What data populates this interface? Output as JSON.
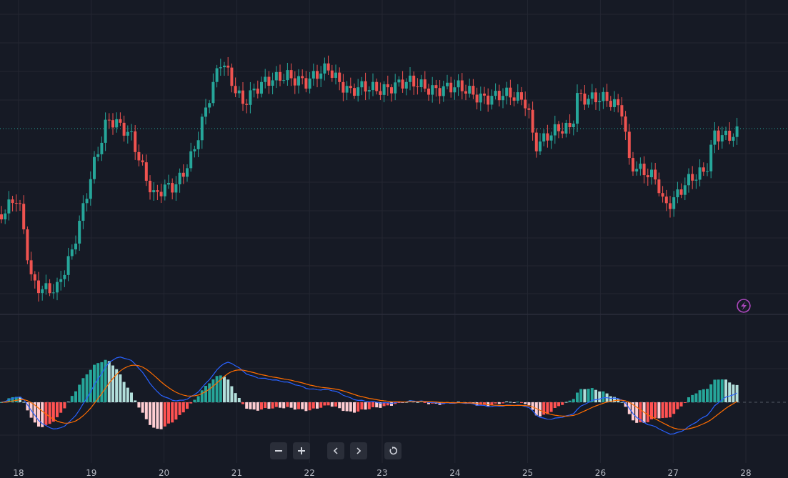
{
  "time_axis": {
    "labels": [
      "18",
      "19",
      "20",
      "21",
      "22",
      "23",
      "24",
      "25",
      "26",
      "27",
      "28"
    ]
  }
}
